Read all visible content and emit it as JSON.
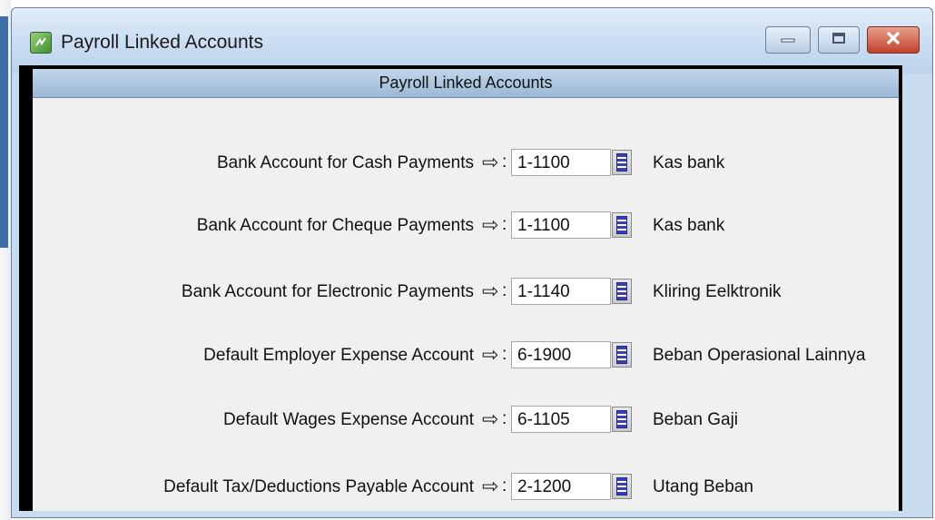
{
  "window": {
    "title": "Payroll Linked Accounts",
    "controls": [
      "minimize-icon",
      "maximize-icon",
      "close-icon"
    ]
  },
  "panel": {
    "header": "Payroll Linked Accounts"
  },
  "rows": [
    {
      "label": "Bank Account for Cash Payments",
      "colon": ":",
      "account": "1-1100",
      "name": "Kas bank"
    },
    {
      "label": "Bank Account for Cheque Payments",
      "colon": ":",
      "account": "1-1100",
      "name": "Kas bank"
    },
    {
      "label": "Bank Account for Electronic Payments",
      "colon": ":",
      "account": "1-1140",
      "name": "Kliring Eelktronik"
    },
    {
      "label": "Default Employer Expense Account",
      "colon": ":",
      "account": "6-1900",
      "name": "Beban Operasional Lainnya"
    },
    {
      "label": "Default Wages Expense Account",
      "colon": ":",
      "account": "6-1105",
      "name": "Beban Gaji"
    },
    {
      "label": "Default Tax/Deductions Payable Account",
      "colon": ":",
      "account": "2-1200",
      "name": "Utang Beban"
    }
  ],
  "colors": {
    "titlebar": "#cddff3",
    "panel_header": "#9ab8d6",
    "close_button": "#c0412a",
    "lookup_icon": "#3b3fb0"
  }
}
